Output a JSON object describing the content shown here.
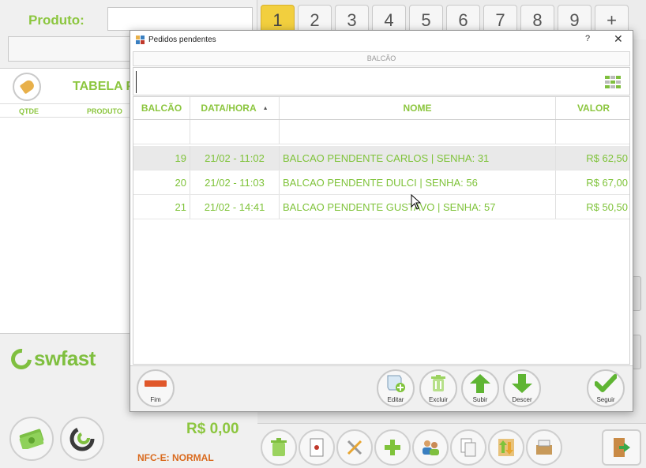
{
  "left_panel": {
    "produto_label": "Produto:",
    "tabela_title": "TABELA P",
    "cart_columns": [
      "QTDE",
      "PRODUTO"
    ],
    "logo_text": "swfast",
    "total": "R$ 0,00",
    "nfce_status": "NFC-E: NORMAL"
  },
  "number_bar": {
    "tabs": [
      "1",
      "2",
      "3",
      "4",
      "5",
      "6",
      "7",
      "8",
      "9",
      "+"
    ],
    "active_tab": "1"
  },
  "dialog": {
    "title": "Pedidos pendentes",
    "help": "?",
    "close": "✕",
    "section_label": "BALCÃO",
    "search": {
      "value": "",
      "placeholder": ""
    },
    "columns": {
      "balcao": "BALCÃO",
      "data_hora": "DATA/HORA",
      "nome": "NOME",
      "valor": "VALOR"
    },
    "sort_indicator": "▲",
    "rows": [
      {
        "balcao": "19",
        "data_hora": "21/02 - 11:02",
        "nome": "BALCAO PENDENTE CARLOS | SENHA: 31",
        "valor": "R$ 62,50",
        "selected": true
      },
      {
        "balcao": "20",
        "data_hora": "21/02 - 11:03",
        "nome": "BALCAO PENDENTE DULCI | SENHA: 56",
        "valor": "R$ 67,00",
        "selected": false
      },
      {
        "balcao": "21",
        "data_hora": "21/02 - 14:41",
        "nome": "BALCAO PENDENTE GUSTAVO | SENHA: 57",
        "valor": "R$ 50,50",
        "selected": false
      }
    ],
    "buttons": {
      "fim": "Fim",
      "editar": "Editar",
      "excluir": "Excluir",
      "subir": "Subir",
      "descer": "Descer",
      "seguir": "Seguir"
    }
  },
  "colors": {
    "accent_green": "#8cc63f",
    "active_tab": "#f2cf3e",
    "minus_red": "#e0572a",
    "nfce_orange": "#d96a1e"
  }
}
